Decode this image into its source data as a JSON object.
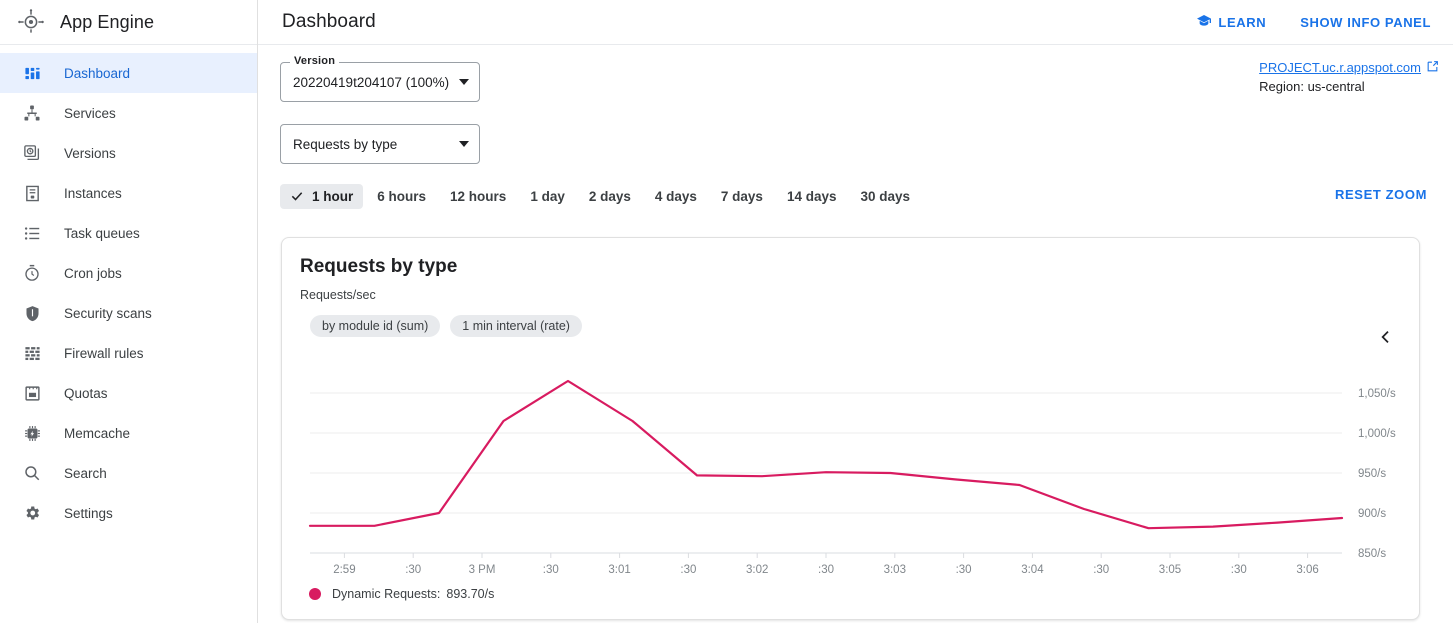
{
  "brand": {
    "title": "App Engine",
    "icon": "app-engine-logo-icon"
  },
  "sidebar": {
    "items": [
      {
        "label": "Dashboard",
        "icon": "dashboard-icon",
        "active": true
      },
      {
        "label": "Services",
        "icon": "services-icon",
        "active": false
      },
      {
        "label": "Versions",
        "icon": "versions-icon",
        "active": false
      },
      {
        "label": "Instances",
        "icon": "instances-icon",
        "active": false
      },
      {
        "label": "Task queues",
        "icon": "task-queues-icon",
        "active": false
      },
      {
        "label": "Cron jobs",
        "icon": "cron-jobs-icon",
        "active": false
      },
      {
        "label": "Security scans",
        "icon": "security-scans-icon",
        "active": false
      },
      {
        "label": "Firewall rules",
        "icon": "firewall-rules-icon",
        "active": false
      },
      {
        "label": "Quotas",
        "icon": "quotas-icon",
        "active": false
      },
      {
        "label": "Memcache",
        "icon": "memcache-icon",
        "active": false
      },
      {
        "label": "Search",
        "icon": "search-icon",
        "active": false
      },
      {
        "label": "Settings",
        "icon": "settings-icon",
        "active": false
      }
    ]
  },
  "header": {
    "title": "Dashboard",
    "learn_label": "LEARN",
    "learn_icon": "graduation-cap-icon",
    "info_panel_label": "SHOW INFO PANEL"
  },
  "controls": {
    "version_select": {
      "label": "Version",
      "value": "20220419t204107 (100%)",
      "caret_icon": "chevron-down-icon"
    },
    "metric_select": {
      "value": "Requests by type",
      "caret_icon": "chevron-down-icon"
    }
  },
  "project": {
    "url": "PROJECT.uc.r.appspot.com",
    "external_icon": "external-link-icon",
    "region": "Region: us-central"
  },
  "range": {
    "items": [
      "1 hour",
      "6 hours",
      "12 hours",
      "1 day",
      "2 days",
      "4 days",
      "7 days",
      "14 days",
      "30 days"
    ],
    "active_index": 0,
    "check_icon": "check-icon",
    "reset_zoom_label": "RESET ZOOM"
  },
  "card": {
    "title": "Requests by type",
    "subtitle": "Requests/sec",
    "chips": [
      "by module id (sum)",
      "1 min interval (rate)"
    ],
    "collapse_icon": "chevron-left-icon"
  },
  "colors": {
    "accent": "#1a73e8",
    "series": "#d81b60",
    "grid": "#eeeeee",
    "text": "#202124",
    "muted": "#80868b",
    "active_tab_bg": "#e8eaed",
    "active_nav_bg": "#e8f0fe"
  },
  "chart_data": {
    "type": "line",
    "title": "Requests by type",
    "ylabel": "Requests/sec",
    "xlabel": "",
    "grid": true,
    "legend_position": "bottom-left",
    "ylim": [
      850,
      1075
    ],
    "yticks": [
      850,
      900,
      950,
      1000,
      1050
    ],
    "ytick_labels": [
      "850/s",
      "900/s",
      "950/s",
      "1,000/s",
      "1,050/s"
    ],
    "xtick_labels": [
      "2:59",
      ":30",
      "3 PM",
      ":30",
      "3:01",
      ":30",
      "3:02",
      ":30",
      "3:03",
      ":30",
      "3:04",
      ":30",
      "3:05",
      ":30",
      "3:06"
    ],
    "series": [
      {
        "name": "Dynamic Requests",
        "color": "#d81b60",
        "legend_value": "893.70/s",
        "x": [
          "2:58:30",
          "2:59",
          "2:59:30",
          "3 PM",
          "3:00:30",
          "3:01",
          "3:01:30",
          "3:02",
          "3:02:30",
          "3:03",
          "3:03:30",
          "3:04",
          "3:04:30",
          "3:05",
          "3:05:30",
          "3:06"
        ],
        "values": [
          884,
          884,
          900,
          1015,
          1065,
          1015,
          947,
          946,
          951,
          950,
          942,
          935,
          905,
          881,
          883,
          888,
          893.7
        ]
      }
    ]
  }
}
